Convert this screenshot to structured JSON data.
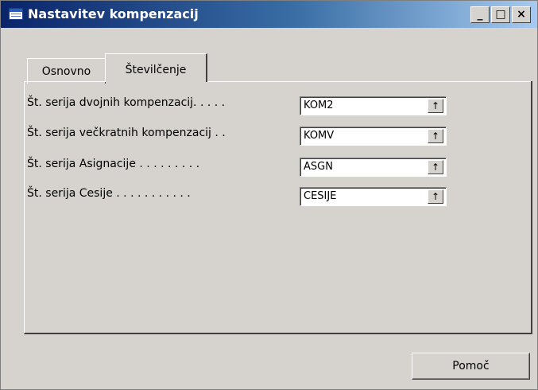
{
  "window": {
    "title": "Nastavitev kompenzacij",
    "buttons": {
      "minimize": "_",
      "maximize": "□",
      "close": "×"
    }
  },
  "tabs": [
    {
      "label": "Osnovno",
      "active": false
    },
    {
      "label": "Številčenje",
      "active": true
    }
  ],
  "fields": [
    {
      "label": "Št. serija dvojnih kompenzacij. . . . .",
      "value": "KOM2"
    },
    {
      "label": "Št. serija večkratnih kompenzacij . .",
      "value": "KOMV"
    },
    {
      "label": "Št. serija Asignacije . . . . . . . . .",
      "value": "ASGN"
    },
    {
      "label": "Št. serija Cesije . . . . . . . . . . .",
      "value": "CESIJE"
    }
  ],
  "lookup_icon": "↑",
  "footer": {
    "help_label": "Pomoč"
  }
}
